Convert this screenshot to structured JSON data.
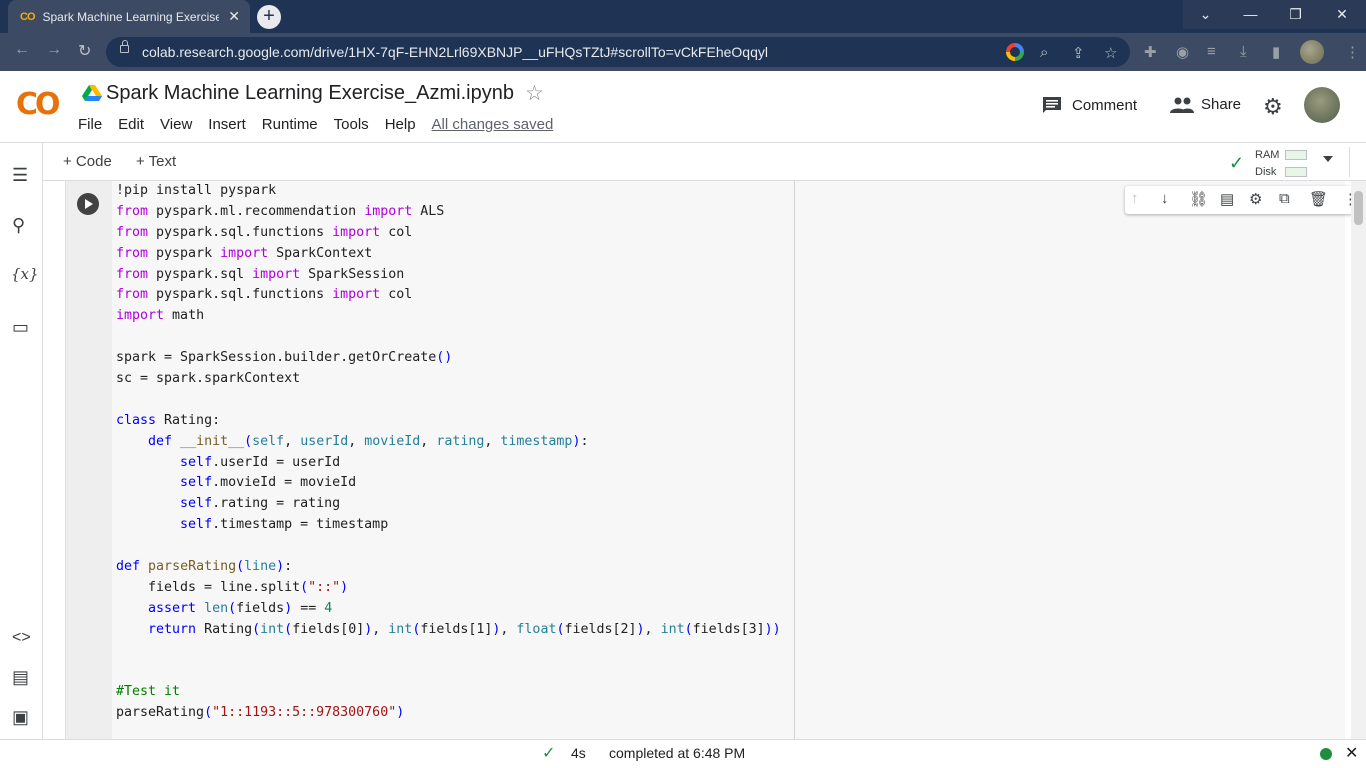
{
  "browser": {
    "tab_title": "Spark Machine Learning Exercise",
    "tab_close": "✕",
    "new_tab": "+",
    "url": "colab.research.google.com/drive/1HX-7qF-EHN2Lrl69XBNJP__uFHQsTZtJ#scrollTo=vCkFEheOqqyl",
    "window_controls": [
      "⌄",
      "—",
      "❐",
      "✕"
    ]
  },
  "header": {
    "logo": "CO",
    "notebook_title": "Spark Machine Learning Exercise_Azmi.ipynb",
    "menu": [
      "File",
      "Edit",
      "View",
      "Insert",
      "Runtime",
      "Tools",
      "Help"
    ],
    "save_status": "All changes saved",
    "comment_label": "Comment",
    "share_label": "Share"
  },
  "toolbar": {
    "code_label": "+ Code",
    "text_label": "+ Text",
    "ram_label": "RAM",
    "disk_label": "Disk"
  },
  "cell": {
    "lines": [
      [
        [
          "",
          "!pip install pyspark"
        ]
      ],
      [
        [
          "kw",
          "from"
        ],
        [
          "",
          " pyspark.ml.recommendation "
        ],
        [
          "kw",
          "import"
        ],
        [
          "",
          " ALS"
        ]
      ],
      [
        [
          "kw",
          "from"
        ],
        [
          "",
          " pyspark.sql.functions "
        ],
        [
          "kw",
          "import"
        ],
        [
          "",
          " col"
        ]
      ],
      [
        [
          "kw",
          "from"
        ],
        [
          "",
          " pyspark "
        ],
        [
          "kw",
          "import"
        ],
        [
          "",
          " SparkContext"
        ]
      ],
      [
        [
          "kw",
          "from"
        ],
        [
          "",
          " pyspark.sql "
        ],
        [
          "kw",
          "import"
        ],
        [
          "",
          " SparkSession"
        ]
      ],
      [
        [
          "kw",
          "from"
        ],
        [
          "",
          " pyspark.sql.functions "
        ],
        [
          "kw",
          "import"
        ],
        [
          "",
          " col"
        ]
      ],
      [
        [
          "kw",
          "import"
        ],
        [
          "",
          " math"
        ]
      ],
      [
        [
          "",
          ""
        ]
      ],
      [
        [
          "",
          "spark = SparkSession.builder.getOrCreate"
        ],
        [
          "sf",
          "()"
        ]
      ],
      [
        [
          "",
          "sc = spark.sparkContext"
        ]
      ],
      [
        [
          "",
          ""
        ]
      ],
      [
        [
          "kw2",
          "class"
        ],
        [
          "",
          " Rating:"
        ]
      ],
      [
        [
          "",
          "    "
        ],
        [
          "kw2",
          "def"
        ],
        [
          "",
          " "
        ],
        [
          "fn",
          "__init__"
        ],
        [
          "sf",
          "("
        ],
        [
          "bi",
          "self"
        ],
        [
          "",
          ", "
        ],
        [
          "bi",
          "userId"
        ],
        [
          "",
          ", "
        ],
        [
          "bi",
          "movieId"
        ],
        [
          "",
          ", "
        ],
        [
          "bi",
          "rating"
        ],
        [
          "",
          ", "
        ],
        [
          "bi",
          "timestamp"
        ],
        [
          "sf",
          ")"
        ],
        [
          "",
          ":"
        ]
      ],
      [
        [
          "",
          "        "
        ],
        [
          "kw2",
          "self"
        ],
        [
          "",
          ".userId = userId"
        ]
      ],
      [
        [
          "",
          "        "
        ],
        [
          "kw2",
          "self"
        ],
        [
          "",
          ".movieId = movieId"
        ]
      ],
      [
        [
          "",
          "        "
        ],
        [
          "kw2",
          "self"
        ],
        [
          "",
          ".rating = rating"
        ]
      ],
      [
        [
          "",
          "        "
        ],
        [
          "kw2",
          "self"
        ],
        [
          "",
          ".timestamp = timestamp"
        ]
      ],
      [
        [
          "",
          ""
        ]
      ],
      [
        [
          "kw2",
          "def"
        ],
        [
          "",
          " "
        ],
        [
          "fn",
          "parseRating"
        ],
        [
          "sf",
          "("
        ],
        [
          "bi",
          "line"
        ],
        [
          "sf",
          ")"
        ],
        [
          "",
          ":"
        ]
      ],
      [
        [
          "",
          "    fields = line.split"
        ],
        [
          "sf",
          "("
        ],
        [
          "str",
          "\"::\""
        ],
        [
          "sf",
          ")"
        ]
      ],
      [
        [
          "",
          "    "
        ],
        [
          "kw2",
          "assert"
        ],
        [
          "",
          " "
        ],
        [
          "bi",
          "len"
        ],
        [
          "sf",
          "("
        ],
        [
          "",
          "fields"
        ],
        [
          "sf",
          ")"
        ],
        [
          "",
          " == "
        ],
        [
          "num",
          "4"
        ]
      ],
      [
        [
          "",
          "    "
        ],
        [
          "kw2",
          "return"
        ],
        [
          "",
          " Rating"
        ],
        [
          "sf",
          "("
        ],
        [
          "bi",
          "int"
        ],
        [
          "sf",
          "("
        ],
        [
          "",
          "fields[0]"
        ],
        [
          "sf",
          ")"
        ],
        [
          "",
          ", "
        ],
        [
          "bi",
          "int"
        ],
        [
          "sf",
          "("
        ],
        [
          "",
          "fields[1]"
        ],
        [
          "sf",
          ")"
        ],
        [
          "",
          ", "
        ],
        [
          "bi",
          "float"
        ],
        [
          "sf",
          "("
        ],
        [
          "",
          "fields[2]"
        ],
        [
          "sf",
          ")"
        ],
        [
          "",
          ", "
        ],
        [
          "bi",
          "int"
        ],
        [
          "sf",
          "("
        ],
        [
          "",
          "fields[3]"
        ],
        [
          "sf",
          "))"
        ]
      ],
      [
        [
          "",
          ""
        ]
      ],
      [
        [
          "",
          ""
        ]
      ],
      [
        [
          "cmt",
          "#Test it"
        ]
      ],
      [
        [
          "",
          "parseRating"
        ],
        [
          "sf",
          "("
        ],
        [
          "str",
          "\"1::1193::5::978300760\""
        ],
        [
          "sf",
          ")"
        ]
      ]
    ]
  },
  "status": {
    "duration": "4s",
    "completed": "completed at 6:48 PM"
  }
}
